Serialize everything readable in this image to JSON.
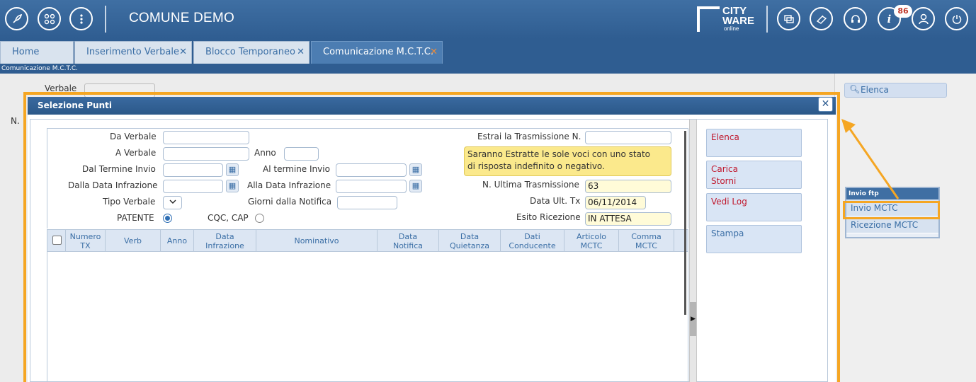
{
  "header": {
    "app_title": "COMUNE DEMO",
    "logo_line1": "CITY",
    "logo_line2": "WARE",
    "logo_line3": "online",
    "notification_count": "86"
  },
  "tabs": [
    {
      "label": "Home"
    },
    {
      "label": "Inserimento Verbale",
      "close": "✕"
    },
    {
      "label": "Blocco Temporaneo",
      "close": "✕"
    },
    {
      "label": "Comunicazione M.C.T.C.",
      "close": "✕"
    }
  ],
  "breadcrumb": "Comunicazione M.C.T.C.",
  "background": {
    "verbale_label": "Verbale",
    "n_label": "N.",
    "elenca_label": "Elenca",
    "ftp_title": "Invio ftp",
    "ftp_items": [
      "Invio MCTC",
      "Ricezione MCTC"
    ]
  },
  "dialog": {
    "title": "Selezione Punti",
    "close": "✕",
    "form": {
      "da_verbale_label": "Da Verbale",
      "a_verbale_label": "A Verbale",
      "anno_label": "Anno",
      "dal_termine_invio_label": "Dal Termine Invio",
      "al_termine_invio_label": "Al termine Invio",
      "dalla_data_infrazione_label": "Dalla Data Infrazione",
      "alla_data_infrazione_label": "Alla Data Infrazione",
      "tipo_verbale_label": "Tipo Verbale",
      "giorni_notifica_label": "Giorni dalla Notifica",
      "patente_label": "PATENTE",
      "cqc_cap_label": "CQC, CAP",
      "estrai_label": "Estrai la Trasmissione N.",
      "note_line1": "Saranno Estratte le sole voci con uno stato",
      "note_line2": "di risposta indefinito o negativo.",
      "ultima_tx_label": "N. Ultima Trasmissione",
      "ultima_tx_value": "63",
      "data_ult_tx_label": "Data Ult. Tx",
      "data_ult_tx_value": "06/11/2014",
      "esito_label": "Esito Ricezione",
      "esito_value": "IN ATTESA",
      "selected_radio": "PATENTE"
    },
    "grid_columns": [
      "Numero\nTX",
      "Verb",
      "Anno",
      "Data\nInfrazione",
      "Nominativo",
      "Data\nNotifica",
      "Data\nQuietanza",
      "Dati\nConducente",
      "Articolo\nMCTC",
      "Comma\nMCTC"
    ],
    "side_buttons": [
      {
        "label": "Elenca"
      },
      {
        "label": "Carica\nStorni"
      },
      {
        "label": "Vedi Log"
      },
      {
        "label": "Stampa"
      }
    ]
  },
  "colors": {
    "header_blue": "#2f5d91",
    "highlight_orange": "#f5a623",
    "action_red": "#c0182d",
    "note_yellow": "#fbe98c"
  }
}
